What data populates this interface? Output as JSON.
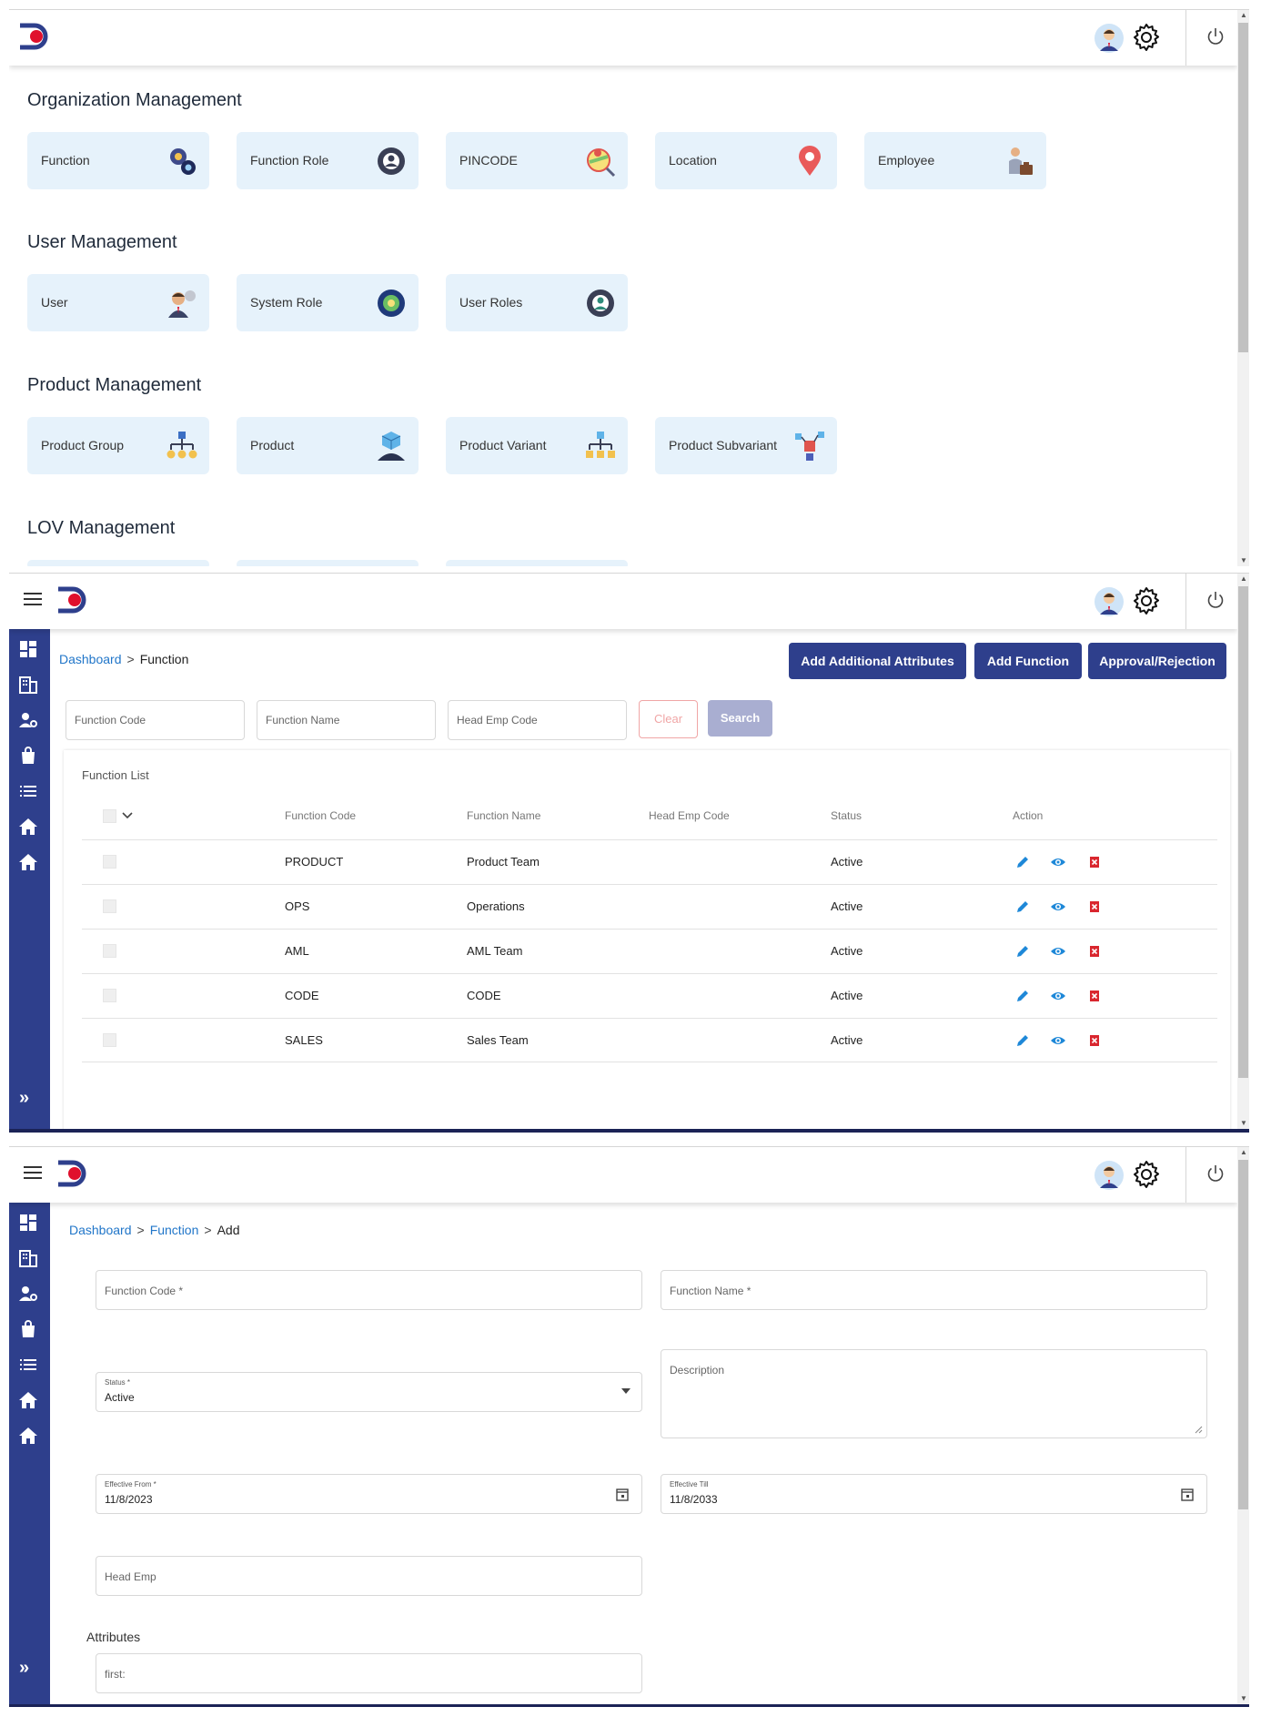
{
  "frame1": {
    "sections": [
      {
        "title": "Organization Management",
        "tiles": [
          "Function",
          "Function Role",
          "PINCODE",
          "Location",
          "Employee"
        ]
      },
      {
        "title": "User Management",
        "tiles": [
          "User",
          "System Role",
          "User Roles"
        ]
      },
      {
        "title": "Product Management",
        "tiles": [
          "Product Group",
          "Product",
          "Product Variant",
          "Product Subvariant"
        ]
      },
      {
        "title": "LOV Management",
        "tiles": []
      }
    ]
  },
  "frame2": {
    "breadcrumb": {
      "root": "Dashboard",
      "current": "Function"
    },
    "buttons": {
      "add_attributes": "Add Additional Attributes",
      "add_function": "Add Function",
      "approval": "Approval/Rejection"
    },
    "filters": {
      "function_code": "Function Code",
      "function_name": "Function Name",
      "head_emp_code": "Head Emp Code",
      "clear": "Clear",
      "search": "Search"
    },
    "list_title": "Function List",
    "columns": [
      "Function Code",
      "Function Name",
      "Head Emp Code",
      "Status",
      "Action"
    ],
    "rows": [
      {
        "code": "PRODUCT",
        "name": "Product Team",
        "head": "",
        "status": "Active"
      },
      {
        "code": "OPS",
        "name": "Operations",
        "head": "",
        "status": "Active"
      },
      {
        "code": "AML",
        "name": "AML Team",
        "head": "",
        "status": "Active"
      },
      {
        "code": "CODE",
        "name": "CODE",
        "head": "",
        "status": "Active"
      },
      {
        "code": "SALES",
        "name": "Sales Team",
        "head": "",
        "status": "Active"
      }
    ]
  },
  "frame3": {
    "breadcrumb": {
      "root": "Dashboard",
      "middle": "Function",
      "current": "Add"
    },
    "fields": {
      "function_code": "Function Code *",
      "function_name": "Function Name *",
      "status_label": "Status *",
      "status_value": "Active",
      "description": "Description",
      "effective_from_label": "Effective From *",
      "effective_from_value": "11/8/2023",
      "effective_till_label": "Effective Till",
      "effective_till_value": "11/8/2033",
      "head_emp": "Head Emp",
      "attributes_label": "Attributes",
      "first": "first:"
    }
  },
  "colors": {
    "primary": "#2e3f8c",
    "link": "#2176c9",
    "tile_bg": "#e6f2fb",
    "logo_red": "#e0102d"
  }
}
